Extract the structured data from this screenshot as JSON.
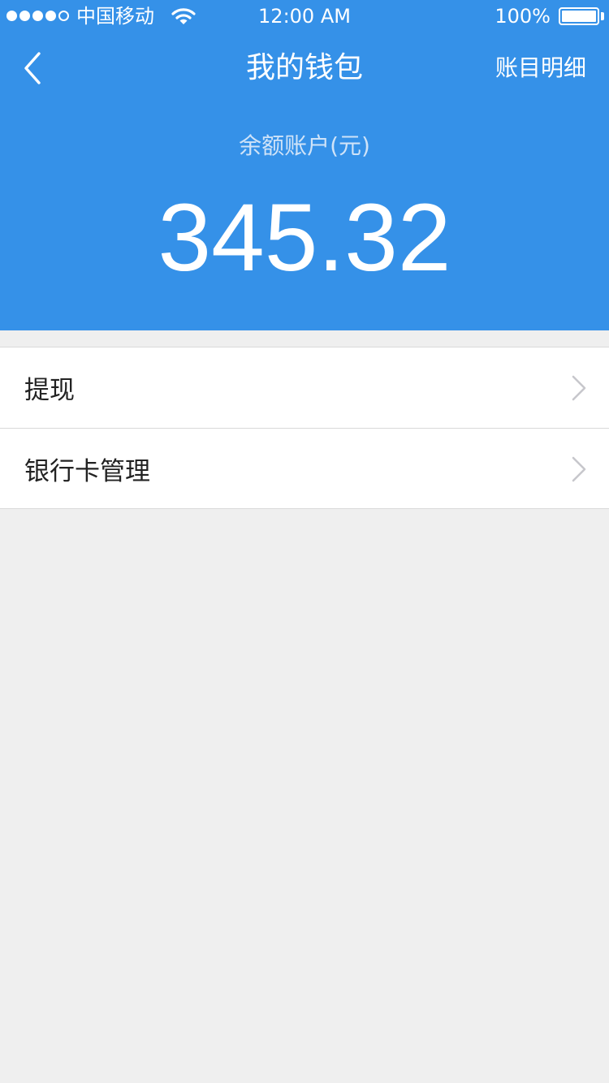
{
  "status_bar": {
    "signal_dots": [
      true,
      true,
      true,
      true,
      false
    ],
    "carrier": "中国移动",
    "wifi_icon": "wifi-icon",
    "time": "12:00 AM",
    "battery_percent": "100%",
    "battery_level": 1.0
  },
  "nav": {
    "back_icon": "chevron-left-icon",
    "title": "我的钱包",
    "ledger_label": "账目明细"
  },
  "balance": {
    "label": "余额账户(元)",
    "amount": "345.32"
  },
  "menu": {
    "items": [
      {
        "label": "提现",
        "icon": "chevron-right-icon"
      },
      {
        "label": "银行卡管理",
        "icon": "chevron-right-icon"
      }
    ]
  },
  "colors": {
    "header_blue": "#3591e8",
    "page_background": "#efefef",
    "divider": "#d9d9d9",
    "chevron": "#c7c7cc"
  }
}
